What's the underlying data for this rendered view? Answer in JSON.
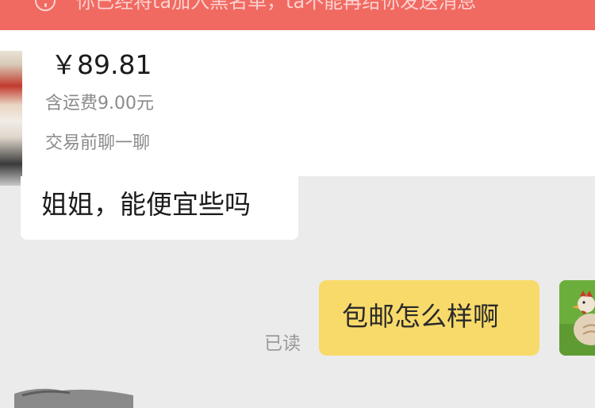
{
  "banner": {
    "text": "你已经将ta加入黑名单，ta不能再给你发送消息",
    "icon": "info-circle-icon",
    "color": "#f06a62"
  },
  "product": {
    "price": "￥89.81",
    "shipping": "含运费9.00元",
    "chat_hint": "交易前聊一聊"
  },
  "messages": {
    "incoming": {
      "text": "姐姐，能便宜些吗"
    },
    "outgoing": {
      "text": "包邮怎么样啊",
      "status": "已读",
      "bubble_color": "#f8da6a"
    }
  }
}
